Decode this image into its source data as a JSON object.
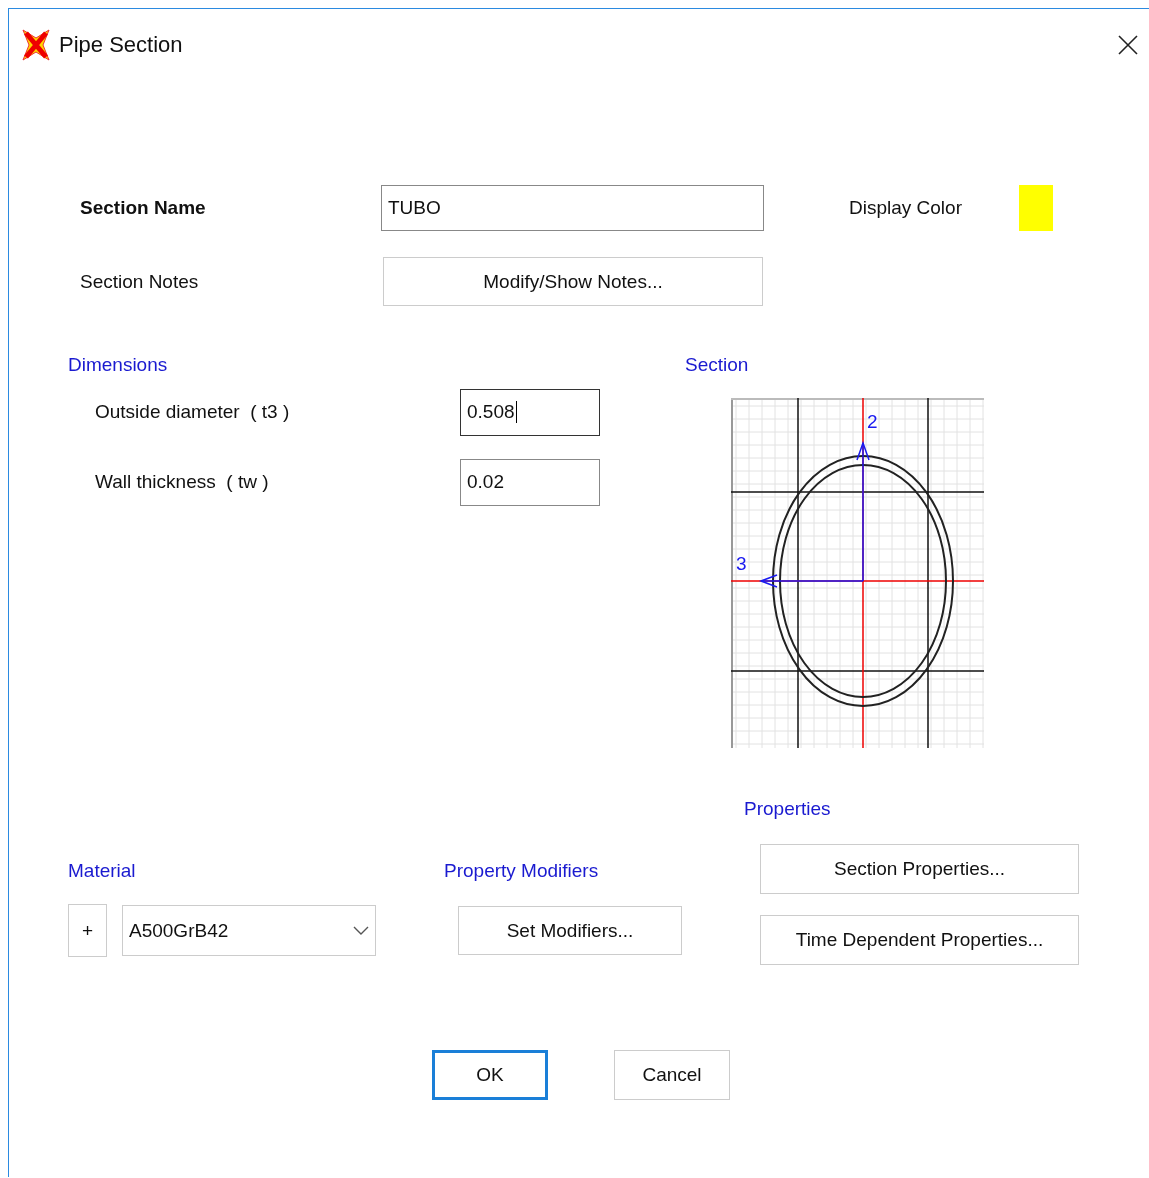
{
  "window": {
    "title": "Pipe Section"
  },
  "section_name": {
    "label": "Section Name",
    "value": "TUBO"
  },
  "display_color": {
    "label": "Display Color",
    "color": "#ffff00"
  },
  "section_notes": {
    "label": "Section Notes",
    "button": "Modify/Show Notes..."
  },
  "dimensions": {
    "title": "Dimensions",
    "fields": [
      {
        "label": "Outside diameter  ( t3 )",
        "value": "0.508",
        "focused": true
      },
      {
        "label": "Wall thickness  ( tw )",
        "value": "0.02",
        "focused": false
      }
    ]
  },
  "section": {
    "title": "Section",
    "axis_labels": [
      "2",
      "3"
    ]
  },
  "properties": {
    "title": "Properties",
    "buttons": [
      "Section Properties...",
      "Time Dependent Properties..."
    ]
  },
  "material": {
    "title": "Material",
    "add_button": "+",
    "value": "A500GrB42"
  },
  "property_modifiers": {
    "title": "Property Modifiers",
    "button": "Set Modifiers..."
  },
  "buttons": [
    {
      "label": "OK",
      "default": true
    },
    {
      "label": "Cancel",
      "default": false
    }
  ]
}
